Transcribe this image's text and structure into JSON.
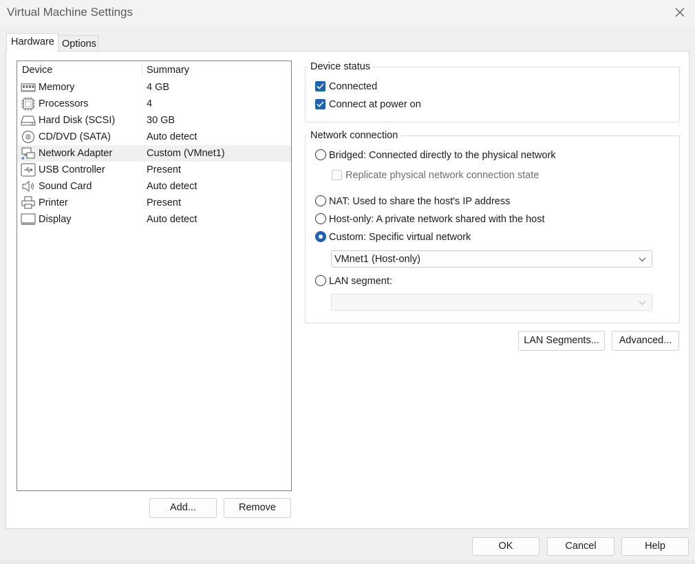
{
  "window": {
    "title": "Virtual Machine Settings",
    "close_icon": "close-icon"
  },
  "tabs": [
    {
      "label": "Hardware",
      "selected": true
    },
    {
      "label": "Options",
      "selected": false
    }
  ],
  "device_list": {
    "header_device": "Device",
    "header_summary": "Summary",
    "rows": [
      {
        "name": "Memory",
        "summary": "4 GB",
        "icon": "memory-icon",
        "selected": false
      },
      {
        "name": "Processors",
        "summary": "4",
        "icon": "processor-icon",
        "selected": false
      },
      {
        "name": "Hard Disk (SCSI)",
        "summary": "30 GB",
        "icon": "hard-disk-icon",
        "selected": false
      },
      {
        "name": "CD/DVD (SATA)",
        "summary": "Auto detect",
        "icon": "cd-dvd-icon",
        "selected": false
      },
      {
        "name": "Network Adapter",
        "summary": "Custom (VMnet1)",
        "icon": "network-adapter-icon",
        "selected": true
      },
      {
        "name": "USB Controller",
        "summary": "Present",
        "icon": "usb-icon",
        "selected": false
      },
      {
        "name": "Sound Card",
        "summary": "Auto detect",
        "icon": "speaker-icon",
        "selected": false
      },
      {
        "name": "Printer",
        "summary": "Present",
        "icon": "printer-icon",
        "selected": false
      },
      {
        "name": "Display",
        "summary": "Auto detect",
        "icon": "display-icon",
        "selected": false
      }
    ],
    "add_label": "Add...",
    "remove_label": "Remove"
  },
  "device_status": {
    "title": "Device status",
    "connected_label": "Connected",
    "connected_checked": true,
    "power_on_label": "Connect at power on",
    "power_on_checked": true
  },
  "network_connection": {
    "title": "Network connection",
    "bridged_label": "Bridged: Connected directly to the physical network",
    "replicate_label": "Replicate physical network connection state",
    "nat_label": "NAT: Used to share the host's IP address",
    "hostonly_label": "Host-only: A private network shared with the host",
    "custom_label": "Custom: Specific virtual network",
    "custom_value": "VMnet1 (Host-only)",
    "lan_label": "LAN segment:",
    "lan_value": "",
    "selected": "custom"
  },
  "actions": {
    "lan_segments_label": "LAN Segments...",
    "advanced_label": "Advanced..."
  },
  "footer": {
    "ok_label": "OK",
    "cancel_label": "Cancel",
    "help_label": "Help"
  },
  "colors": {
    "accent": "#1a63b8",
    "selected_row": "#f0f0f0"
  }
}
